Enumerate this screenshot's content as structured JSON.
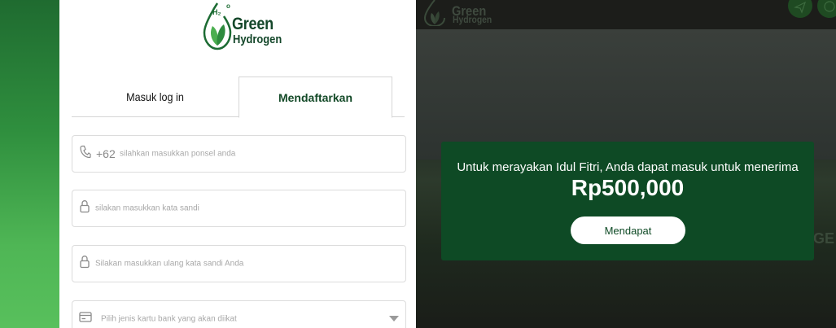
{
  "brand": {
    "line1": "Green",
    "line2": "Hydrogen",
    "formula": "H₂",
    "superscript": "o"
  },
  "tabs": {
    "login": "Masuk log in",
    "register": "Mendaftarkan"
  },
  "form": {
    "phone_prefix": "+62",
    "phone_placeholder": "silahkan masukkan ponsel anda",
    "password_placeholder": "silakan masukkan kata sandi",
    "confirm_placeholder": "Silakan masukkan ulang kata sandi Anda",
    "bank_placeholder": "Pilih jenis kartu bank yang akan diikat"
  },
  "background": {
    "banner_text": "GE"
  },
  "modal": {
    "message": "Untuk merayakan Idul Fitri, Anda dapat masuk untuk menerima",
    "amount": "Rp500,000",
    "button": "Mendapat"
  },
  "colors": {
    "brand_green": "#0e4a25",
    "strip_green": "#4fb655"
  },
  "icons": [
    "phone-icon",
    "lock-icon",
    "card-icon",
    "chevron-down-icon",
    "leaf-icon",
    "send-icon",
    "refresh-icon"
  ]
}
